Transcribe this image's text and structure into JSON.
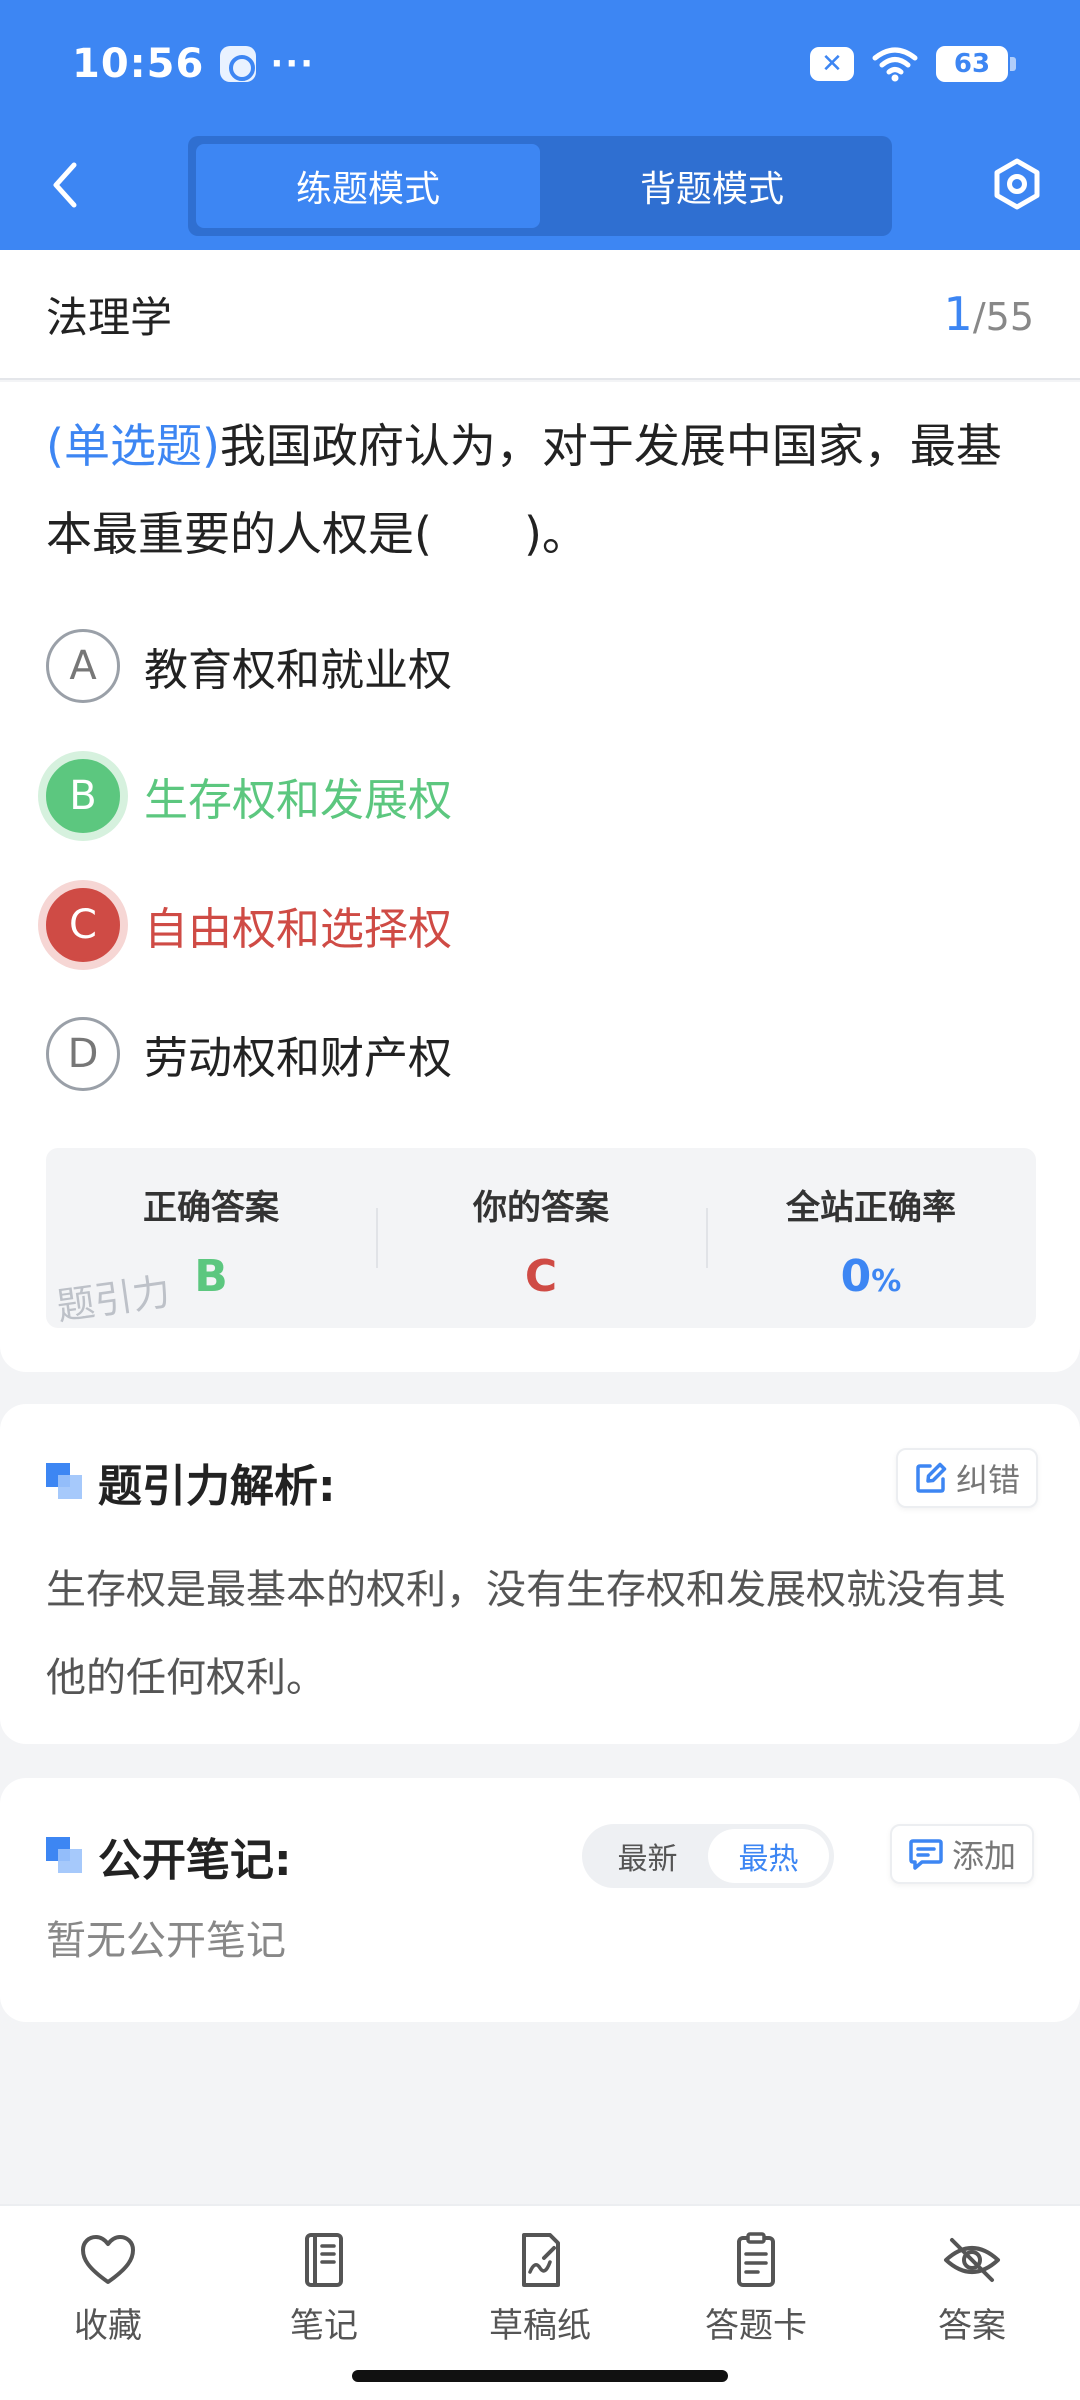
{
  "status_bar": {
    "time": "10:56",
    "more": "···",
    "battery": "63",
    "x_badge": "✕"
  },
  "header": {
    "modes": [
      {
        "label": "练题模式",
        "active": true
      },
      {
        "label": "背题模式",
        "active": false
      }
    ],
    "back_icon": "chevron-left-icon",
    "settings_icon": "hexagon-settings-icon"
  },
  "subject": {
    "title": "法理学",
    "current": "1",
    "separator": "/",
    "total": "55"
  },
  "question": {
    "type_label": "(单选题)",
    "text": "我国政府认为，对于发展中国家，最基本最重要的人权是(　　)。",
    "options": [
      {
        "letter": "A",
        "text": "教育权和就业权",
        "state": "normal"
      },
      {
        "letter": "B",
        "text": "生存权和发展权",
        "state": "correct"
      },
      {
        "letter": "C",
        "text": "自由权和选择权",
        "state": "wrong"
      },
      {
        "letter": "D",
        "text": "劳动权和财产权",
        "state": "normal"
      }
    ]
  },
  "answer_summary": {
    "correct_label": "正确答案",
    "correct_value": "B",
    "yours_label": "你的答案",
    "yours_value": "C",
    "rate_label": "全站正确率",
    "rate_value": "0",
    "rate_unit": "%",
    "watermark": "题引力"
  },
  "analysis": {
    "title": "题引力解析:",
    "correct_btn": "纠错",
    "text": "生存权是最基本的权利，没有生存权和发展权就没有其他的任何权利。"
  },
  "notes": {
    "title": "公开笔记:",
    "sort": [
      {
        "label": "最新",
        "active": false
      },
      {
        "label": "最热",
        "active": true
      }
    ],
    "add_btn": "添加",
    "empty": "暂无公开笔记"
  },
  "toolbar": {
    "items": [
      {
        "label": "收藏",
        "icon": "heart-icon"
      },
      {
        "label": "笔记",
        "icon": "notebook-icon"
      },
      {
        "label": "草稿纸",
        "icon": "draft-paper-icon"
      },
      {
        "label": "答题卡",
        "icon": "answer-card-icon"
      },
      {
        "label": "答案",
        "icon": "eye-off-icon"
      }
    ]
  },
  "colors": {
    "primary": "#3d86f3",
    "correct": "#5cc77f",
    "wrong": "#cf4b45"
  }
}
